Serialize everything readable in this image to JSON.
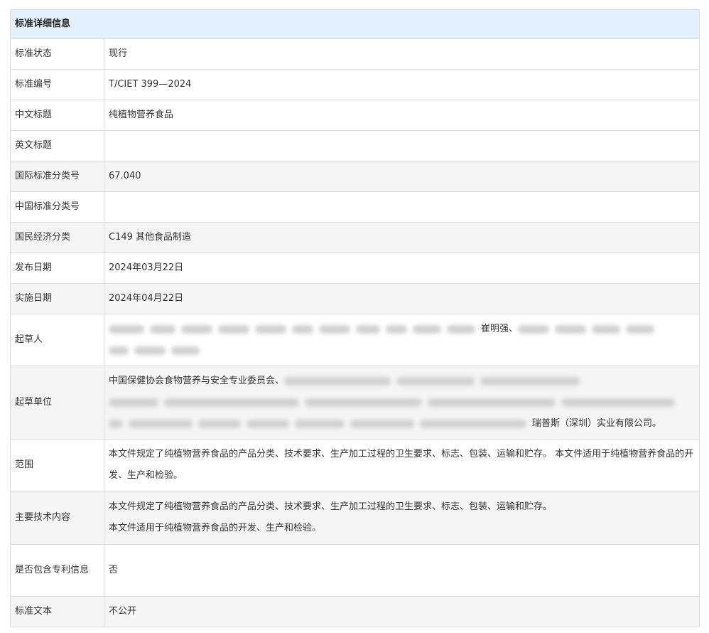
{
  "header": {
    "title": "标准详细信息"
  },
  "rows": {
    "status": {
      "label": "标准状态",
      "value": "现行"
    },
    "number": {
      "label": "标准编号",
      "value": "T/CIET 399—2024"
    },
    "cn_title": {
      "label": "中文标题",
      "value": "纯植物营养食品"
    },
    "en_title": {
      "label": "英文标题",
      "value": ""
    },
    "ics": {
      "label": "国际标准分类号",
      "value": "67.040"
    },
    "ccs": {
      "label": "中国标准分类号",
      "value": ""
    },
    "economy": {
      "label": "国民经济分类",
      "value": "C149 其他食品制造"
    },
    "publish_date": {
      "label": "发布日期",
      "value": "2024年03月22日"
    },
    "impl_date": {
      "label": "实施日期",
      "value": "2024年04月22日"
    },
    "drafters": {
      "label": "起草人",
      "visible_name": "崔明强、"
    },
    "units": {
      "label": "起草单位",
      "visible_start": "中国保健协会食物营养与安全专业委员会、",
      "visible_end": "瑞普斯（深圳）实业有限公司。"
    },
    "scope": {
      "label": "范围",
      "value": "本文件规定了纯植物营养食品的产品分类、技术要求、生产加工过程的卫生要求、标志、包装、运输和贮存。 本文件适用于纯植物营养食品的开发、生产和检验。"
    },
    "tech": {
      "label": "主要技术内容",
      "line1": "本文件规定了纯植物营养食品的产品分类、技术要求、生产加工过程的卫生要求、标志、包装、运输和贮存。",
      "line2": "本文件适用于纯植物营养食品的开发、生产和检验。"
    },
    "patent": {
      "label": "是否包含专利信息",
      "value": "否"
    },
    "text": {
      "label": "标准文本",
      "value": "不公开"
    }
  }
}
